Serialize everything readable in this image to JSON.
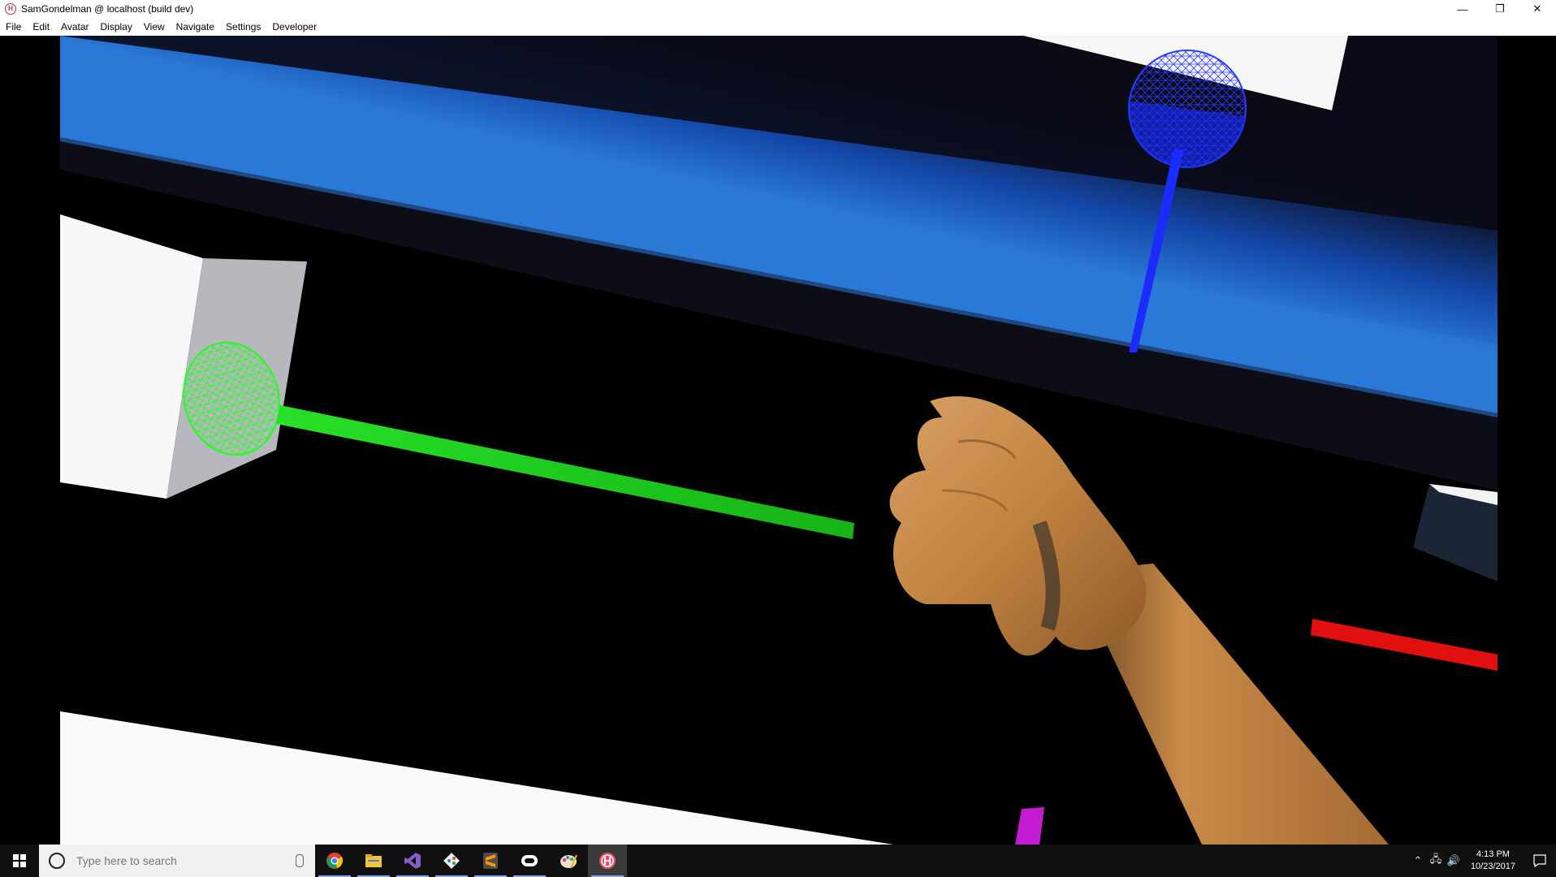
{
  "window": {
    "title": "SamGondelman @ localhost (build dev)",
    "minimize_glyph": "—",
    "restore_glyph": "❐",
    "close_glyph": "✕"
  },
  "menu": {
    "items": [
      "File",
      "Edit",
      "Avatar",
      "Display",
      "View",
      "Navigate",
      "Settings",
      "Developer"
    ]
  },
  "scene": {
    "sky_color": "#1f63c9",
    "left_hand_ray_color": "#19c419",
    "right_hand_ray_color": "#e01010",
    "head_ray_color": "#1a2bff",
    "extra_ray_color": "#c21bd1",
    "hand_color": "#c58a4e"
  },
  "taskbar": {
    "search_placeholder": "Type here to search",
    "apps": [
      "chrome-icon",
      "file-explorer-icon",
      "visual-studio-icon",
      "git-icon",
      "sublime-text-icon",
      "oculus-icon",
      "paint-icon",
      "high-fidelity-icon"
    ],
    "clock": {
      "time": "4:13 PM",
      "date": "10/23/2017"
    }
  }
}
